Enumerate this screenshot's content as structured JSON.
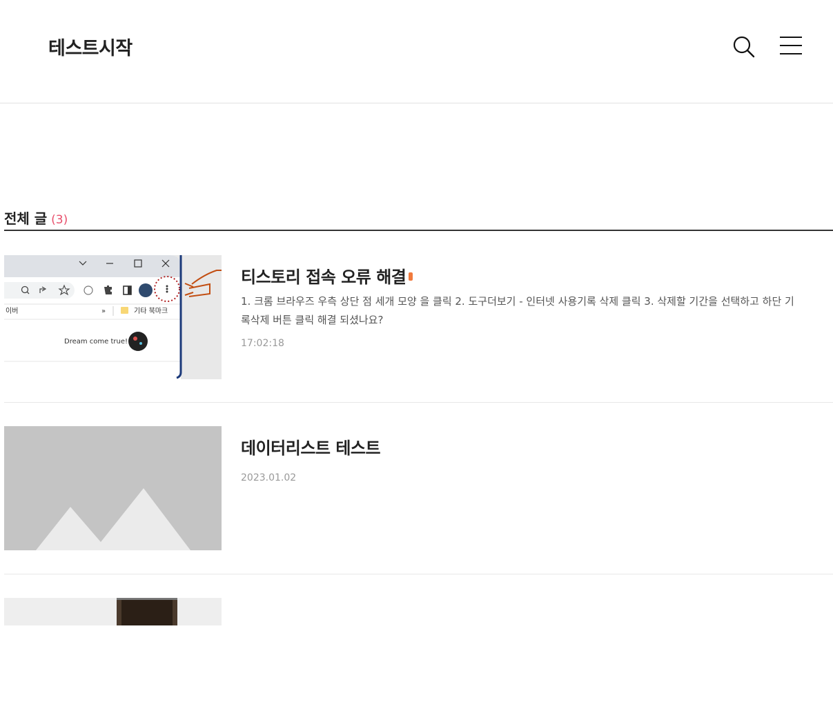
{
  "header": {
    "site_title": "테스트시작",
    "search_icon": "search-icon",
    "menu_icon": "hamburger-menu-icon"
  },
  "category": {
    "title": "전체 글",
    "count": "(3)"
  },
  "posts": [
    {
      "title": "티스토리 접속 오류 해결",
      "excerpt": "1. 크롬 브라우즈 우측 상단 점 세개 모양 을 클릭 2. 도구더보기 - 인터넷 사용기록 삭제 클릭 3. 삭제할 기간을 선택하고 하단 기록삭제 버튼 클릭 해결 되셨나요?",
      "date": "17:02:18",
      "new": true,
      "thumbnail": {
        "kind": "browser-screenshot",
        "bookmark_left": "이버",
        "bookmark_more": "»",
        "bookmark_folder": "기타 북마크",
        "profile_text": "Dream come true!"
      }
    },
    {
      "title": "데이터리스트 테스트",
      "date": "2023.01.02",
      "thumbnail": {
        "kind": "placeholder-mountain"
      }
    },
    {
      "thumbnail": {
        "kind": "photo"
      }
    }
  ],
  "colors": {
    "accent_count": "#e8506c",
    "new_badge": "#f17a3d",
    "placeholder_bg": "#c4c4c4",
    "placeholder_mountain": "#ebebeb"
  }
}
